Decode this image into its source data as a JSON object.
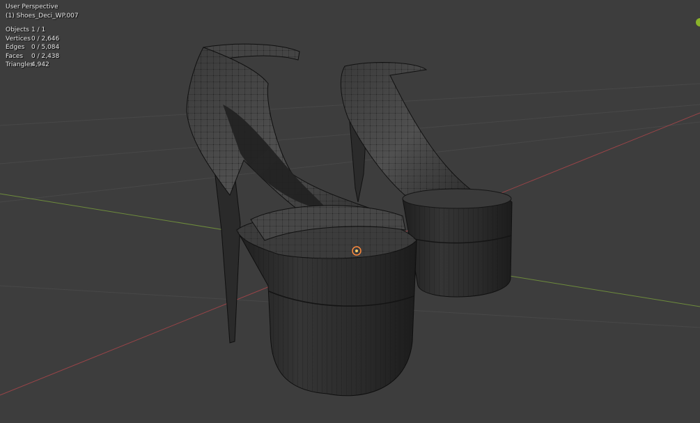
{
  "viewport": {
    "view_name": "User Perspective",
    "active_object": "(1) Shoes_Deci_WP.007"
  },
  "stats": [
    {
      "label": "Objects",
      "value": "1 / 1"
    },
    {
      "label": "Vertices",
      "value": "0 / 2,646"
    },
    {
      "label": "Edges",
      "value": "0 / 5,084"
    },
    {
      "label": "Faces",
      "value": "0 / 2,438"
    },
    {
      "label": "Triangles",
      "value": "4,942"
    }
  ],
  "colors": {
    "background": "#3d3d3d",
    "x_axis": "#9a4448",
    "y_axis": "#6e8c3c",
    "mesh": "#2d2d2d",
    "wire": "#0c0c0c",
    "origin": "#ff8a3c",
    "gizmo": "#8ab32a"
  },
  "icons": [
    "navigation-gizmo-icon",
    "object-origin-icon"
  ]
}
